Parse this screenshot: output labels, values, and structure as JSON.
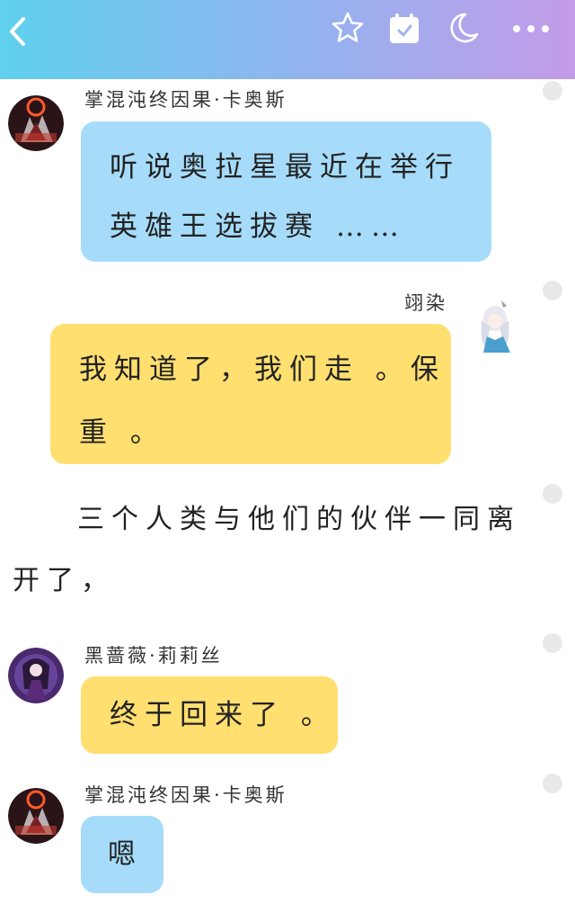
{
  "header": {
    "back_icon": "back-icon",
    "favorite_icon": "star-icon",
    "calendar_icon": "calendar-check-icon",
    "night_mode_icon": "moon-icon",
    "more_icon": "more-icon",
    "gradient": [
      "#5fd0ee",
      "#c39be8"
    ]
  },
  "messages": [
    {
      "speaker": "掌混沌终因果·卡奥斯",
      "lines": [
        "听说奥拉星最近在举行",
        "英雄王选拔赛 ……"
      ],
      "bubble_color": "#a6dcfa"
    },
    {
      "speaker": "翊染",
      "lines": [
        "我知道了，我们走 。保",
        "重 。"
      ],
      "bubble_color": "#ffdf70"
    },
    {
      "narration": [
        "三个人类与他们的伙伴一同离",
        "开了，"
      ]
    },
    {
      "speaker": "黑蔷薇·莉莉丝",
      "lines": [
        "终于回来了 。"
      ],
      "bubble_color": "#ffdf70"
    },
    {
      "speaker": "掌混沌终因果·卡奥斯",
      "lines": [
        "嗯"
      ],
      "bubble_color": "#a6dcfa"
    }
  ]
}
